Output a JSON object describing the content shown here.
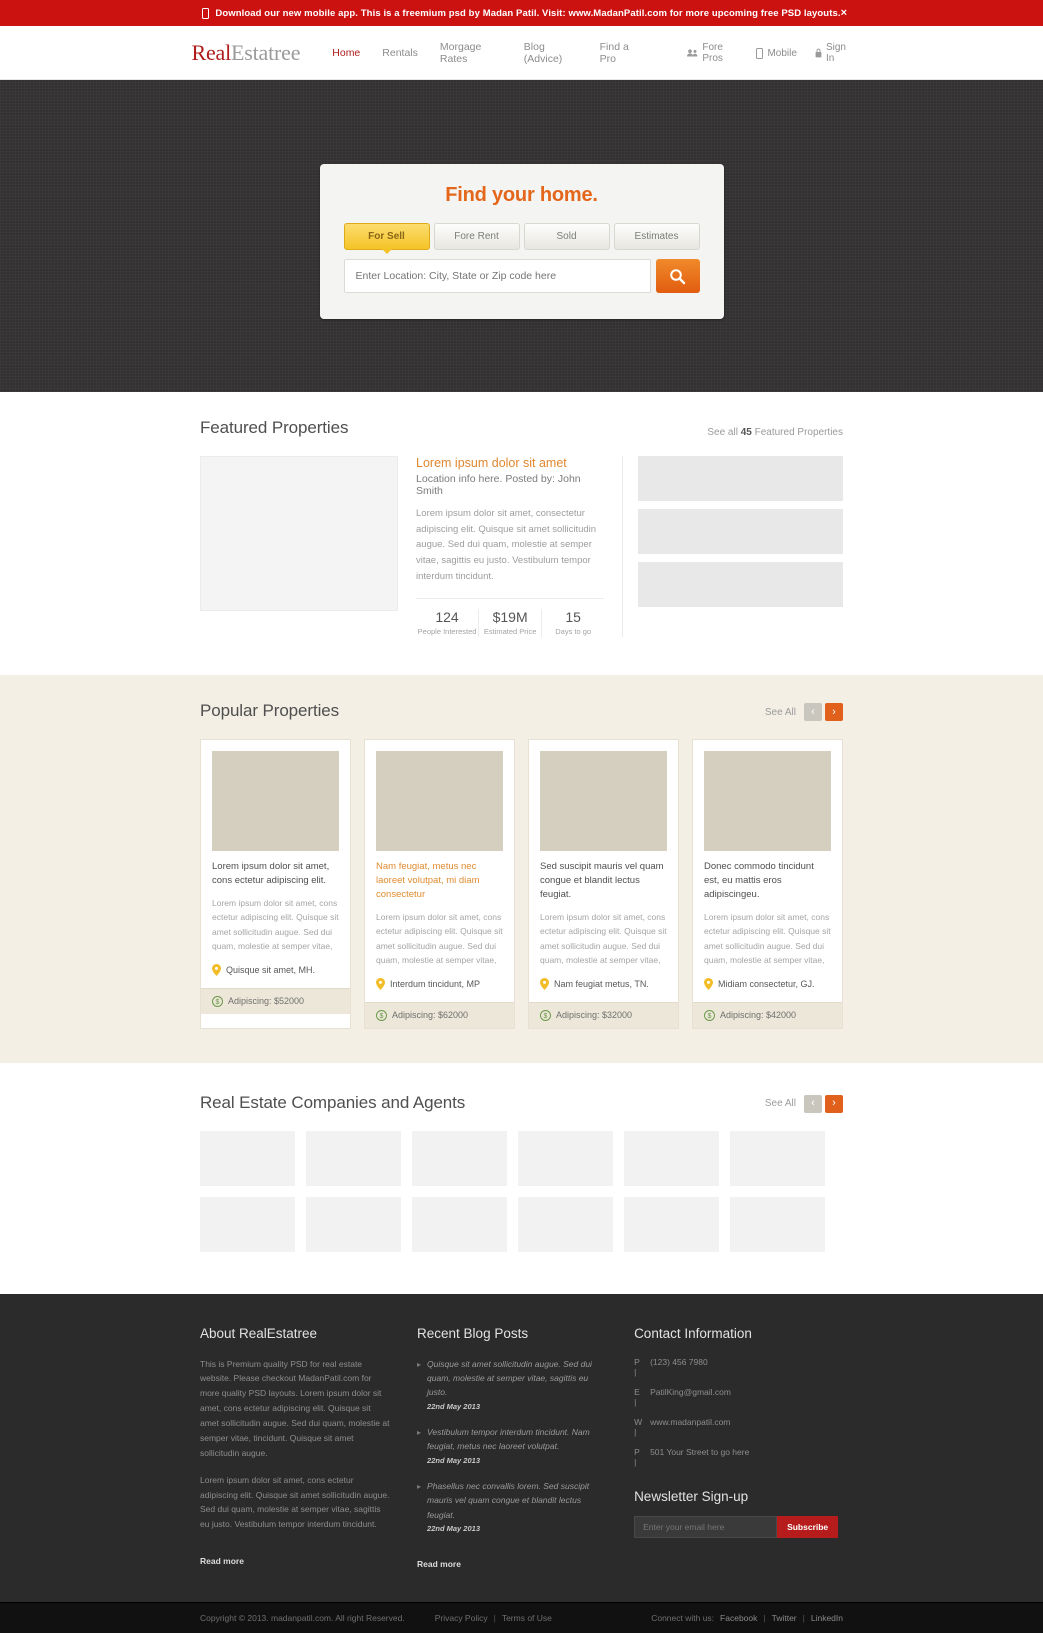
{
  "promo": {
    "text": "Download our new mobile app. This is a freemium psd by Madan Patil. Visit: www.MadanPatil.com for more upcoming free PSD layouts.",
    "close_label": "×",
    "bg_color": "#cc1111"
  },
  "header": {
    "logo_first": "Real",
    "logo_second": "Estatree",
    "nav": [
      {
        "label": "Home",
        "active": true
      },
      {
        "label": "Rentals",
        "active": false
      },
      {
        "label": "Morgage Rates",
        "active": false
      },
      {
        "label": "Blog (Advice)",
        "active": false
      },
      {
        "label": "Find a Pro",
        "active": false
      }
    ],
    "nav_right": [
      {
        "label": "Fore Pros",
        "icon": "people-icon"
      },
      {
        "label": "Mobile",
        "icon": "mobile-icon"
      },
      {
        "label": "Sign In",
        "icon": "lock-icon"
      }
    ]
  },
  "hero": {
    "title": "Find your home.",
    "tabs": [
      {
        "label": "For Sell",
        "active": true
      },
      {
        "label": "Fore Rent",
        "active": false
      },
      {
        "label": "Sold",
        "active": false
      },
      {
        "label": "Estimates",
        "active": false
      }
    ],
    "search_placeholder": "Enter Location: City, State or Zip code here",
    "search_value": "",
    "search_icon": "search-icon",
    "accent_color": "#e3661b"
  },
  "featured": {
    "title": "Featured Properties",
    "link_prefix": "See all ",
    "link_count": "45",
    "link_suffix": " Featured Properties",
    "property": {
      "title": "Lorem ipsum dolor sit amet",
      "subtitle": "Location info here. Posted by: John Smith",
      "description": "Lorem ipsum dolor sit amet, consectetur adipiscing elit. Quisque sit amet sollicitudin augue. Sed dui quam, molestie at semper vitae, sagittis eu justo. Vestibulum tempor interdum tincidunt.",
      "stats": [
        {
          "value": "124",
          "label": "People Interested"
        },
        {
          "value": "$19M",
          "label": "Estimated Price"
        },
        {
          "value": "15",
          "label": "Days to go"
        }
      ]
    }
  },
  "popular": {
    "title": "Popular Properties",
    "see_all": "See All",
    "prev_icon": "chevron-left-icon",
    "next_icon": "chevron-right-icon",
    "cards": [
      {
        "title": "Lorem ipsum dolor sit amet, cons ectetur adipiscing elit.",
        "highlight": false,
        "description": "Lorem ipsum dolor sit amet, cons ectetur adipiscing elit. Quisque sit amet sollicitudin augue. Sed dui quam, molestie at semper vitae,",
        "location": "Quisque sit amet, MH.",
        "price_label": "Adipiscing: $52000"
      },
      {
        "title": "Nam feugiat, metus nec laoreet volutpat, mi diam consectetur",
        "highlight": true,
        "description": "Lorem ipsum dolor sit amet, cons ectetur adipiscing elit. Quisque sit amet sollicitudin augue. Sed dui quam, molestie at semper vitae,",
        "location": "Interdum tincidunt, MP",
        "price_label": "Adipiscing: $62000"
      },
      {
        "title": "Sed suscipit mauris vel quam congue et blandit lectus feugiat.",
        "highlight": false,
        "description": "Lorem ipsum dolor sit amet, cons ectetur adipiscing elit. Quisque sit amet sollicitudin augue. Sed dui quam, molestie at semper vitae,",
        "location": "Nam feugiat metus, TN.",
        "price_label": "Adipiscing: $32000"
      },
      {
        "title": "Donec commodo tincidunt est, eu mattis eros adipiscingeu.",
        "highlight": false,
        "description": "Lorem ipsum dolor sit amet, cons ectetur adipiscing elit. Quisque sit amet sollicitudin augue. Sed dui quam, molestie at semper vitae,",
        "location": "Midiam consectetur, GJ.",
        "price_label": "Adipiscing: $42000"
      }
    ]
  },
  "companies": {
    "title": "Real Estate Companies and Agents",
    "see_all": "See All",
    "logo_count": 12
  },
  "footer": {
    "about": {
      "title": "About RealEstatree",
      "paragraph1": "This is Premium quality PSD for real estate website. Please checkout MadanPatil.com for more quality PSD layouts. Lorem ipsum dolor sit amet, cons ectetur adipiscing elit. Quisque sit amet sollicitudin augue. Sed dui quam, molestie at semper vitae, tincidunt. Quisque sit amet sollicitudin augue.",
      "paragraph2": "Lorem ipsum dolor sit amet, cons ectetur adipiscing elit. Quisque sit amet sollicitudin augue. Sed dui quam, molestie at semper vitae, sagittis eu justo. Vestibulum tempor interdum tincidunt.",
      "read_more": "Read more"
    },
    "blog": {
      "title": "Recent Blog Posts",
      "posts": [
        {
          "text": "Quisque sit amet sollicitudin augue. Sed dui quam, molestie at semper vitae, sagittis eu justo.",
          "date": "22nd May 2013"
        },
        {
          "text": "Vestibulum tempor interdum tincidunt. Nam feugiat, metus nec laoreet volutpat.",
          "date": "22nd May 2013"
        },
        {
          "text": "Phasellus nec convallis lorem. Sed suscipit mauris vel quam congue et blandit lectus feugiat.",
          "date": "22nd May 2013"
        }
      ],
      "read_more": "Read more"
    },
    "contact": {
      "title": "Contact Information",
      "rows": [
        {
          "key": "P |",
          "value": "(123) 456 7980"
        },
        {
          "key": "E |",
          "value": "PatilKing@gmail.com"
        },
        {
          "key": "W |",
          "value": "www.madanpatil.com"
        },
        {
          "key": "P |",
          "value": "501 Your Street to go here"
        }
      ]
    },
    "newsletter": {
      "title": "Newsletter Sign-up",
      "placeholder": "Enter your email here",
      "value": "",
      "button_label": "Subscribe",
      "button_color": "#b71c1c"
    },
    "bottom": {
      "copyright": "Copyright © 2013. madanpatil.com. All right Reserved.",
      "links": [
        {
          "label": "Privacy Policy"
        },
        {
          "label": "Terms of Use"
        }
      ],
      "connect_label": "Connect with us:",
      "socials": [
        {
          "label": "Facebook"
        },
        {
          "label": "Twitter"
        },
        {
          "label": "LinkedIn"
        }
      ]
    }
  }
}
